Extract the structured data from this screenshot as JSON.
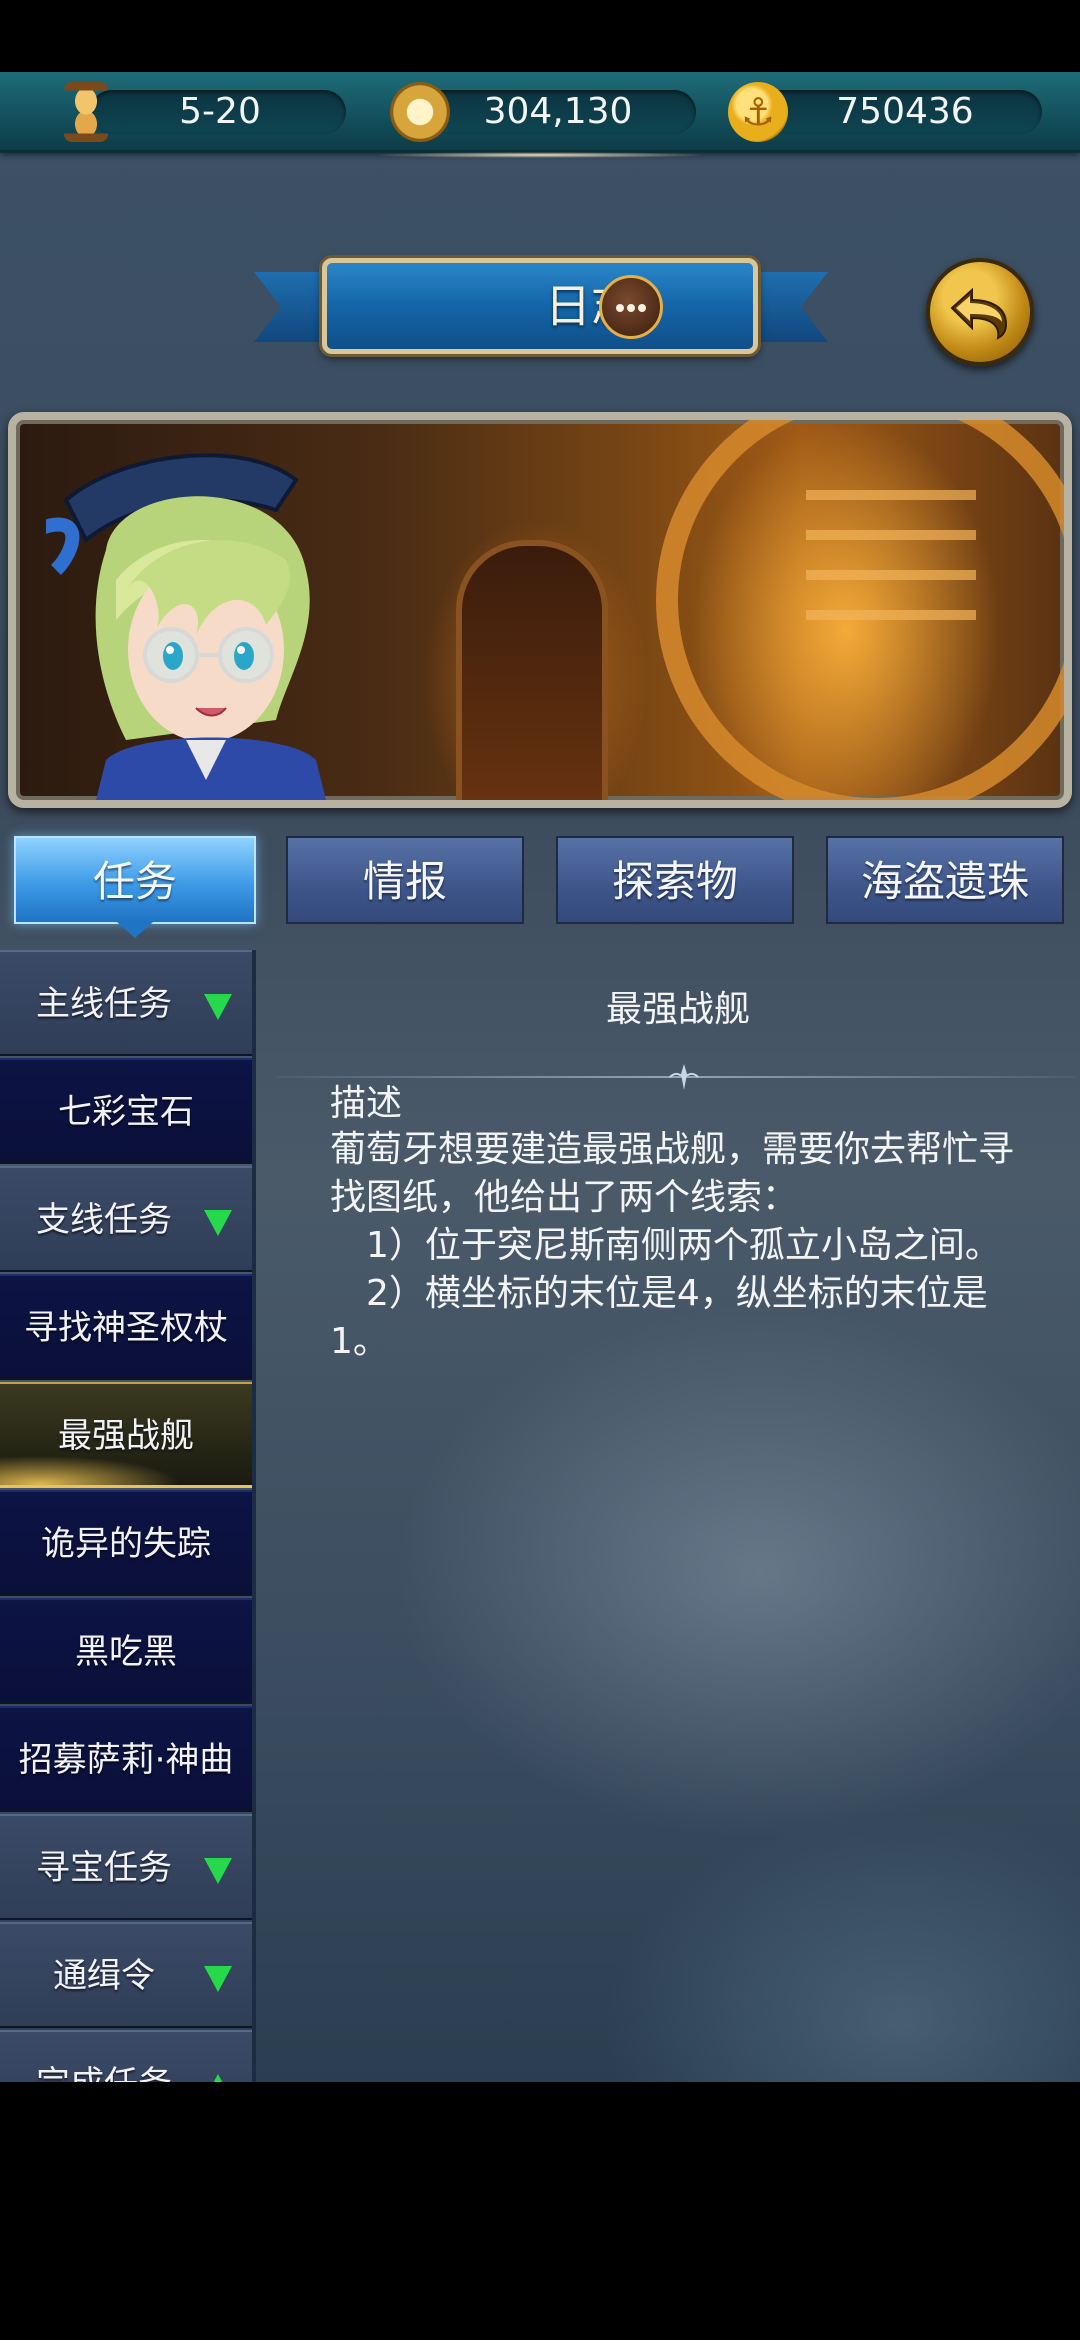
{
  "resources": {
    "stage": "5-20",
    "compass_count": "304,130",
    "coins": "750436"
  },
  "header": {
    "title": "日志"
  },
  "tabs": [
    {
      "label": "任务",
      "active": true
    },
    {
      "label": "情报",
      "active": false
    },
    {
      "label": "探索物",
      "active": false
    },
    {
      "label": "海盗遗珠",
      "active": false
    }
  ],
  "quest_list": [
    {
      "label": "主线任务",
      "type": "category",
      "arrow": "down"
    },
    {
      "label": "七彩宝石",
      "type": "quest"
    },
    {
      "label": "支线任务",
      "type": "category",
      "arrow": "down"
    },
    {
      "label": "寻找神圣权杖",
      "type": "quest"
    },
    {
      "label": "最强战舰",
      "type": "quest",
      "selected": true
    },
    {
      "label": "诡异的失踪",
      "type": "quest"
    },
    {
      "label": "黑吃黑",
      "type": "quest"
    },
    {
      "label": "招募萨莉·神曲",
      "type": "quest"
    },
    {
      "label": "寻宝任务",
      "type": "category",
      "arrow": "down"
    },
    {
      "label": "通缉令",
      "type": "category",
      "arrow": "down"
    },
    {
      "label": "完成任务",
      "type": "category",
      "arrow": "up"
    }
  ],
  "detail": {
    "title": "最强战舰",
    "heading": "描述",
    "body": "葡萄牙想要建造最强战舰，需要你去帮忙寻找图纸，他给出了两个线索：\n　1）位于突尼斯南侧两个孤立小岛之间。\n　2）横坐标的末位是4，纵坐标的末位是1。"
  },
  "colors": {
    "active_tab": "#3d9ae6",
    "tab": "#3e558a",
    "category_row": "#2f3d57",
    "quest_row": "#0d1446",
    "selected_glow": "#e7c35a",
    "arrow_green": "#26d94a"
  }
}
